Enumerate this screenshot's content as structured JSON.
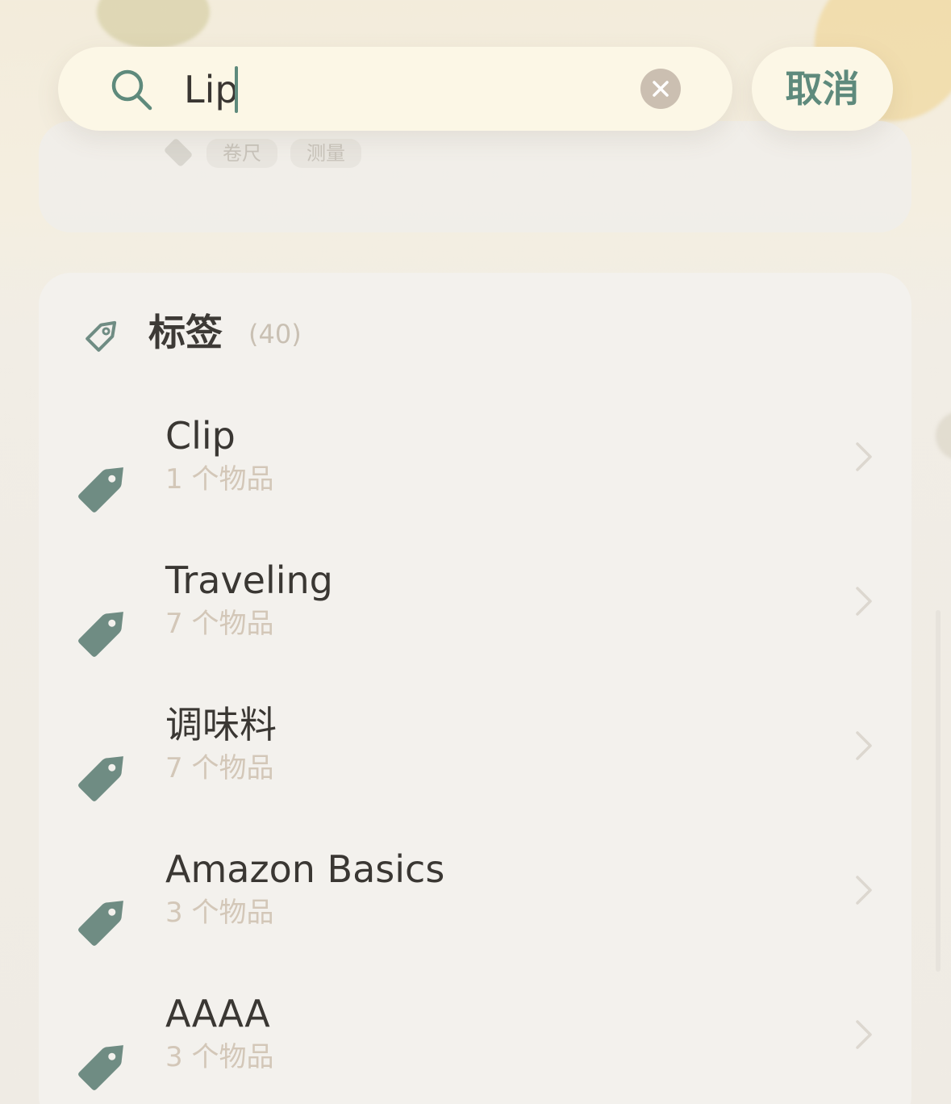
{
  "background_hint_tags": [
    "卷尺",
    "测量"
  ],
  "search": {
    "value": "Lip",
    "cancel_label": "取消"
  },
  "section": {
    "title": "标签",
    "count": "(40)"
  },
  "tags": [
    {
      "name": "Clip",
      "count": "1 个物品"
    },
    {
      "name": "Traveling",
      "count": "7 个物品"
    },
    {
      "name": "调味料",
      "count": "7 个物品"
    },
    {
      "name": "Amazon Basics",
      "count": "3 个物品"
    },
    {
      "name": "AAAA",
      "count": "3 个物品"
    }
  ],
  "colors": {
    "accent": "#5e8a7c",
    "tag_icon": "#6f8c83",
    "search_bg": "#fcf7e6",
    "muted_text": "#d3c7b8"
  },
  "icons": {
    "search": "search-icon",
    "clear": "clear-icon",
    "section": "tag-outline-icon",
    "row": "tag-filled-icon",
    "chevron": "chevron-right-icon"
  }
}
